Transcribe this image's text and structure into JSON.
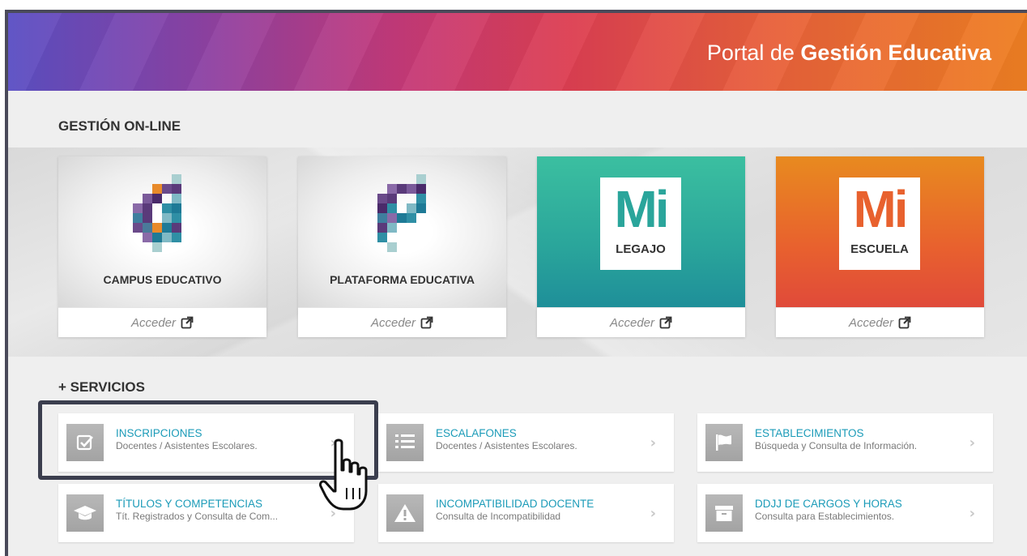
{
  "header": {
    "title_prefix": "Portal de",
    "title_bold": "Gestión Educativa"
  },
  "online_section": {
    "title": "GESTIÓN ON-LINE",
    "cards": [
      {
        "label": "CAMPUS EDUCATIVO",
        "access": "Acceder",
        "logo_icon": "campus-logo-icon"
      },
      {
        "label": "PLATAFORMA EDUCATIVA",
        "access": "Acceder",
        "logo_icon": "plataforma-logo-icon"
      },
      {
        "logo_big": "Mi",
        "logo_sub": "LEGAJO",
        "access": "Acceder",
        "color": "#2aa59b"
      },
      {
        "logo_big": "Mi",
        "logo_sub": "ESCUELA",
        "access": "Acceder",
        "color": "#e8612e"
      }
    ]
  },
  "services_section": {
    "title": "+ SERVICIOS",
    "items": [
      {
        "title": "INSCRIPCIONES",
        "subtitle": "Docentes / Asistentes Escolares.",
        "icon": "checkbox-icon"
      },
      {
        "title": "ESCALAFONES",
        "subtitle": "Docentes / Asistentes Escolares.",
        "icon": "list-icon"
      },
      {
        "title": "ESTABLECIMIENTOS",
        "subtitle": "Búsqueda y Consulta de Información.",
        "icon": "flag-icon"
      },
      {
        "title": "TÍTULOS Y COMPETENCIAS",
        "subtitle": "Tít. Registrados y Consulta de Com...",
        "icon": "graduation-cap-icon"
      },
      {
        "title": "INCOMPATIBILIDAD DOCENTE",
        "subtitle": "Consulta de Incompatibilidad",
        "icon": "warning-icon"
      },
      {
        "title": "DDJJ DE CARGOS Y HORAS",
        "subtitle": "Consulta para Establecimientos.",
        "icon": "archive-box-icon"
      }
    ],
    "chevron": "›"
  },
  "colors": {
    "link": "#1b9bb8",
    "teal": "#2aa59b",
    "orange": "#e8612e",
    "highlight_border": "#3b3e4e"
  }
}
